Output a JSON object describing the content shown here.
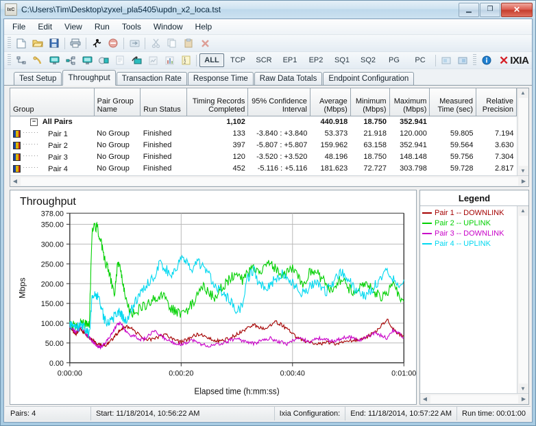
{
  "window": {
    "title": "C:\\Users\\Tim\\Desktop\\zyxel_pla5405\\updn_x2_loca.tst",
    "app_icon_label": "IxC",
    "minimize": "—",
    "maximize": "□",
    "close": "✕"
  },
  "menu": [
    {
      "label": "File"
    },
    {
      "label": "Edit"
    },
    {
      "label": "View"
    },
    {
      "label": "Run"
    },
    {
      "label": "Tools"
    },
    {
      "label": "Window"
    },
    {
      "label": "Help"
    }
  ],
  "toolbar1": [
    {
      "icon": "new-document-icon",
      "glyph": "🗋"
    },
    {
      "icon": "open-folder-icon",
      "glyph": "📂"
    },
    {
      "icon": "save-icon",
      "glyph": "💾"
    },
    {
      "icon": "print-icon",
      "glyph": "🖨"
    },
    {
      "icon": "run-test-icon",
      "glyph": "🏃"
    },
    {
      "icon": "stop-test-icon",
      "glyph": "⛔"
    },
    {
      "icon": "refresh-icon",
      "glyph": "🔄"
    },
    {
      "icon": "cut-icon",
      "glyph": "✂"
    },
    {
      "icon": "copy-icon",
      "glyph": "🗐"
    },
    {
      "icon": "paste-icon",
      "glyph": "📋"
    },
    {
      "icon": "delete-icon",
      "glyph": "✖"
    }
  ],
  "toolbar2": [
    {
      "icon": "pair-setup-icon",
      "glyph": "⌐"
    },
    {
      "icon": "endpoint-phone-icon",
      "glyph": "📞"
    },
    {
      "icon": "endpoint1-icon",
      "glyph": "🖥"
    },
    {
      "icon": "network-icon",
      "glyph": "🕸"
    },
    {
      "icon": "endpoint2-icon",
      "glyph": "🖥"
    },
    {
      "icon": "scripts-icon",
      "glyph": "🎞"
    },
    {
      "icon": "edit-script-icon",
      "glyph": "📝"
    },
    {
      "icon": "console-icon",
      "glyph": "🗔"
    },
    {
      "icon": "report-icon",
      "glyph": "🗒"
    },
    {
      "icon": "chart-icon",
      "glyph": "📊"
    },
    {
      "icon": "counters-icon",
      "glyph": "½"
    }
  ],
  "protocol_buttons": [
    {
      "label": "ALL",
      "active": true
    },
    {
      "label": "TCP",
      "active": false
    },
    {
      "label": "SCR",
      "active": false
    },
    {
      "label": "EP1",
      "active": false
    },
    {
      "label": "EP2",
      "active": false
    },
    {
      "label": "SQ1",
      "active": false
    },
    {
      "label": "SQ2",
      "active": false
    },
    {
      "label": "PG",
      "active": false
    },
    {
      "label": "PC",
      "active": false
    }
  ],
  "toolbar2_trailing": [
    {
      "icon": "export-icon",
      "glyph": "🗖"
    },
    {
      "icon": "import-icon",
      "glyph": "🗗"
    },
    {
      "icon": "info-icon",
      "glyph": "ℹ"
    }
  ],
  "brand": {
    "mark": "✕",
    "name": "IXIA"
  },
  "tabs": [
    {
      "label": "Test Setup",
      "active": false
    },
    {
      "label": "Throughput",
      "active": true
    },
    {
      "label": "Transaction Rate",
      "active": false
    },
    {
      "label": "Response Time",
      "active": false
    },
    {
      "label": "Raw Data Totals",
      "active": false
    },
    {
      "label": "Endpoint Configuration",
      "active": false
    }
  ],
  "table": {
    "headers": [
      "Group",
      "Pair Group Name",
      "Run Status",
      "Timing Records Completed",
      "95% Confidence Interval",
      "Average (Mbps)",
      "Minimum (Mbps)",
      "Maximum (Mbps)",
      "Measured Time (sec)",
      "Relative Precision"
    ],
    "total_row": {
      "group": "All Pairs",
      "pair_group_name": "",
      "run_status": "",
      "timing_records": "1,102",
      "confidence": "",
      "average": "440.918",
      "minimum": "18.750",
      "maximum": "352.941",
      "measured_time": "",
      "precision": ""
    },
    "rows": [
      {
        "group": "Pair 1",
        "pair_group_name": "No Group",
        "run_status": "Finished",
        "timing_records": "133",
        "confidence": "-3.840 : +3.840",
        "average": "53.373",
        "minimum": "21.918",
        "maximum": "120.000",
        "measured_time": "59.805",
        "precision": "7.194"
      },
      {
        "group": "Pair 2",
        "pair_group_name": "No Group",
        "run_status": "Finished",
        "timing_records": "397",
        "confidence": "-5.807 : +5.807",
        "average": "159.962",
        "minimum": "63.158",
        "maximum": "352.941",
        "measured_time": "59.564",
        "precision": "3.630"
      },
      {
        "group": "Pair 3",
        "pair_group_name": "No Group",
        "run_status": "Finished",
        "timing_records": "120",
        "confidence": "-3.520 : +3.520",
        "average": "48.196",
        "minimum": "18.750",
        "maximum": "148.148",
        "measured_time": "59.756",
        "precision": "7.304"
      },
      {
        "group": "Pair 4",
        "pair_group_name": "No Group",
        "run_status": "Finished",
        "timing_records": "452",
        "confidence": "-5.116 : +5.116",
        "average": "181.623",
        "minimum": "72.727",
        "maximum": "303.798",
        "measured_time": "59.728",
        "precision": "2.817"
      }
    ]
  },
  "legend": {
    "title": "Legend",
    "items": [
      {
        "label": "Pair 1 -- DOWNLINK",
        "color": "#a40000"
      },
      {
        "label": "Pair 2 -- UPLINK",
        "color": "#00d000"
      },
      {
        "label": "Pair 3 -- DOWNLINK",
        "color": "#c800c8"
      },
      {
        "label": "Pair 4 -- UPLINK",
        "color": "#00d8f0"
      }
    ]
  },
  "statusbar": {
    "pairs": "Pairs: 4",
    "start": "Start: 11/18/2014, 10:56:22 AM",
    "config": "Ixia Configuration:",
    "end": "End: 11/18/2014, 10:57:22 AM",
    "runtime": "Run time: 00:01:00"
  },
  "chart_data": {
    "type": "line",
    "title": "Throughput",
    "xlabel": "Elapsed time (h:mm:ss)",
    "ylabel": "Mbps",
    "xlim": [
      0,
      60
    ],
    "ylim": [
      0,
      378
    ],
    "grid": true,
    "legend_position": "right-panel",
    "xticks": [
      {
        "value": 0,
        "label": "0:00:00"
      },
      {
        "value": 20,
        "label": "0:00:20"
      },
      {
        "value": 40,
        "label": "0:00:40"
      },
      {
        "value": 60,
        "label": "0:01:00"
      }
    ],
    "yticks": [
      {
        "value": 0,
        "label": "0.00"
      },
      {
        "value": 50,
        "label": "50.00"
      },
      {
        "value": 100,
        "label": "100.00"
      },
      {
        "value": 150,
        "label": "150.00"
      },
      {
        "value": 200,
        "label": "200.00"
      },
      {
        "value": 250,
        "label": "250.00"
      },
      {
        "value": 300,
        "label": "300.00"
      },
      {
        "value": 350,
        "label": "350.00"
      },
      {
        "value": 378,
        "label": "378.00"
      }
    ],
    "series": [
      {
        "name": "Pair 1 -- DOWNLINK",
        "color": "#a40000",
        "x": [
          0,
          0.5,
          1,
          1.5,
          2,
          2.5,
          3,
          3.5,
          4,
          4.5,
          5,
          5.5,
          6,
          6.5,
          7,
          7.5,
          8,
          8.5,
          9,
          9.5,
          10,
          11,
          12,
          13,
          14,
          15,
          16,
          17,
          18,
          19,
          20,
          21,
          22,
          23,
          24,
          25,
          26,
          27,
          28,
          29,
          30,
          31,
          32,
          33,
          34,
          35,
          36,
          37,
          38,
          39,
          40,
          41,
          42,
          43,
          44,
          45,
          46,
          47,
          48,
          49,
          50,
          51,
          52,
          53,
          54,
          55,
          56,
          57,
          58,
          59,
          60
        ],
        "y": [
          88,
          80,
          72,
          78,
          84,
          76,
          70,
          62,
          58,
          52,
          48,
          46,
          45,
          46,
          50,
          58,
          66,
          74,
          80,
          86,
          92,
          88,
          76,
          64,
          58,
          60,
          66,
          72,
          64,
          56,
          52,
          58,
          66,
          72,
          68,
          62,
          58,
          54,
          58,
          64,
          72,
          80,
          88,
          96,
          90,
          84,
          96,
          104,
          96,
          86,
          74,
          62,
          56,
          52,
          50,
          48,
          52,
          50,
          48,
          54,
          58,
          56,
          60,
          64,
          70,
          80,
          96,
          110,
          86,
          74,
          68
        ]
      },
      {
        "name": "Pair 2 -- UPLINK",
        "color": "#00d000",
        "x": [
          0,
          0.5,
          1,
          1.5,
          2,
          2.5,
          3,
          3.5,
          4,
          4.5,
          5,
          5.5,
          6,
          6.5,
          7,
          7.5,
          8,
          8.5,
          9,
          9.5,
          10,
          11,
          12,
          13,
          14,
          15,
          16,
          17,
          18,
          19,
          20,
          21,
          22,
          23,
          24,
          25,
          26,
          27,
          28,
          29,
          30,
          31,
          32,
          33,
          34,
          35,
          36,
          37,
          38,
          39,
          40,
          41,
          42,
          43,
          44,
          45,
          46,
          47,
          48,
          49,
          50,
          51,
          52,
          53,
          54,
          55,
          56,
          57,
          58,
          59,
          60
        ],
        "y": [
          98,
          96,
          94,
          96,
          100,
          98,
          96,
          98,
          330,
          345,
          340,
          310,
          280,
          250,
          230,
          200,
          170,
          240,
          250,
          200,
          160,
          120,
          130,
          140,
          150,
          160,
          170,
          175,
          140,
          130,
          120,
          130,
          150,
          170,
          190,
          175,
          165,
          185,
          200,
          215,
          230,
          210,
          225,
          240,
          230,
          245,
          250,
          235,
          215,
          225,
          240,
          215,
          200,
          225,
          235,
          215,
          200,
          185,
          200,
          215,
          190,
          175,
          190,
          205,
          190,
          175,
          165,
          180,
          200,
          175,
          155
        ]
      },
      {
        "name": "Pair 3 -- DOWNLINK",
        "color": "#c800c8",
        "x": [
          0,
          0.5,
          1,
          1.5,
          2,
          2.5,
          3,
          3.5,
          4,
          4.5,
          5,
          5.5,
          6,
          6.5,
          7,
          7.5,
          8,
          8.5,
          9,
          9.5,
          10,
          11,
          12,
          13,
          14,
          15,
          16,
          17,
          18,
          19,
          20,
          21,
          22,
          23,
          24,
          25,
          26,
          27,
          28,
          29,
          30,
          31,
          32,
          33,
          34,
          35,
          36,
          37,
          38,
          39,
          40,
          41,
          42,
          43,
          44,
          45,
          46,
          47,
          48,
          49,
          50,
          51,
          52,
          53,
          54,
          55,
          56,
          57,
          58,
          59,
          60
        ],
        "y": [
          92,
          86,
          78,
          82,
          88,
          80,
          72,
          64,
          56,
          48,
          42,
          40,
          44,
          52,
          62,
          74,
          86,
          96,
          100,
          92,
          80,
          70,
          64,
          58,
          66,
          80,
          72,
          62,
          54,
          50,
          46,
          52,
          58,
          50,
          46,
          42,
          44,
          48,
          52,
          58,
          62,
          56,
          52,
          48,
          54,
          58,
          62,
          56,
          52,
          48,
          56,
          62,
          58,
          54,
          58,
          62,
          58,
          54,
          58,
          62,
          66,
          62,
          58,
          62,
          70,
          76,
          68,
          62,
          82,
          76,
          62
        ]
      },
      {
        "name": "Pair 4 -- UPLINK",
        "color": "#00d8f0",
        "x": [
          0,
          0.5,
          1,
          1.5,
          2,
          2.5,
          3,
          3.5,
          4,
          4.5,
          5,
          5.5,
          6,
          6.5,
          7,
          7.5,
          8,
          8.5,
          9,
          9.5,
          10,
          11,
          12,
          13,
          14,
          15,
          16,
          17,
          18,
          19,
          20,
          21,
          22,
          23,
          24,
          25,
          26,
          27,
          28,
          29,
          30,
          31,
          32,
          33,
          34,
          35,
          36,
          37,
          38,
          39,
          40,
          41,
          42,
          43,
          44,
          45,
          46,
          47,
          48,
          49,
          50,
          51,
          52,
          53,
          54,
          55,
          56,
          57,
          58,
          59,
          60
        ],
        "y": [
          96,
          92,
          88,
          90,
          94,
          88,
          80,
          72,
          160,
          175,
          170,
          150,
          120,
          100,
          105,
          110,
          118,
          125,
          130,
          115,
          105,
          130,
          160,
          185,
          200,
          215,
          250,
          240,
          225,
          235,
          265,
          250,
          230,
          255,
          240,
          220,
          200,
          185,
          170,
          150,
          130,
          145,
          215,
          235,
          200,
          185,
          200,
          210,
          225,
          215,
          200,
          185,
          175,
          190,
          205,
          195,
          180,
          200,
          215,
          230,
          210,
          190,
          175,
          165,
          180,
          200,
          220,
          235,
          215,
          200,
          210
        ]
      }
    ]
  }
}
